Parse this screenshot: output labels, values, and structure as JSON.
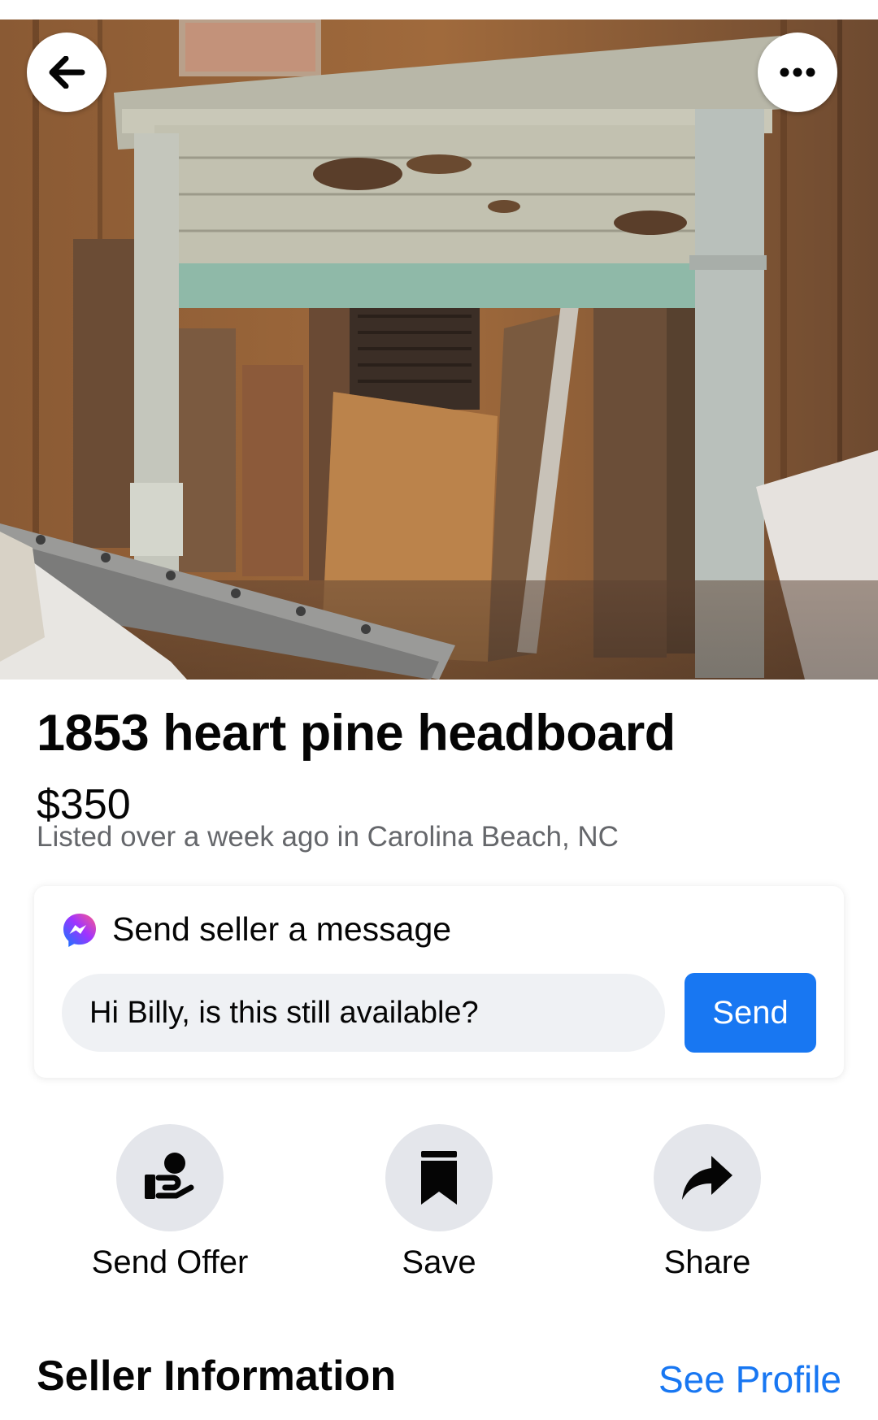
{
  "photo": {
    "description_icon": "listing-photo"
  },
  "top_controls": {
    "back_icon": "arrow-left-icon",
    "more_icon": "more-horizontal-icon"
  },
  "listing": {
    "title": "1853 heart pine headboard",
    "price": "$350",
    "listed_text": "Listed over a week ago in Carolina Beach, NC"
  },
  "message": {
    "heading": "Send seller a message",
    "heading_icon": "messenger-icon",
    "input_value": "Hi Billy, is this still available?",
    "send_label": "Send"
  },
  "actions": [
    {
      "label": "Send Offer",
      "icon": "offer-hand-icon"
    },
    {
      "label": "Save",
      "icon": "bookmark-icon"
    },
    {
      "label": "Share",
      "icon": "share-arrow-icon"
    }
  ],
  "seller": {
    "heading": "Seller Information",
    "see_profile_label": "See Profile"
  },
  "colors": {
    "accent": "#1877f2",
    "secondary_text": "#65676b",
    "input_bg": "#eff1f4",
    "action_bg": "#e4e6eb"
  }
}
